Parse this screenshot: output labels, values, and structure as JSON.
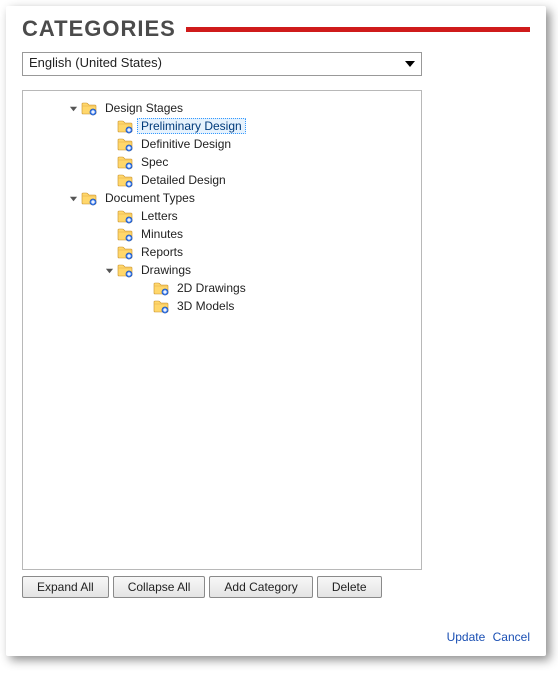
{
  "header": {
    "title": "CATEGORIES"
  },
  "language": {
    "selected": "English (United States)"
  },
  "buttons": {
    "expand_all": "Expand All",
    "collapse_all": "Collapse All",
    "add_category": "Add Category",
    "delete": "Delete"
  },
  "footer": {
    "update": "Update",
    "cancel": "Cancel"
  },
  "colors": {
    "accent": "#cf1b1b",
    "link": "#1a4fb3",
    "selection": "#e6f2fd"
  },
  "tree": [
    {
      "label": "Design Stages",
      "icon": "folder-tag-icon",
      "expanded": true,
      "children": [
        {
          "label": "Preliminary Design",
          "icon": "folder-tag-icon",
          "selected": true
        },
        {
          "label": "Definitive Design",
          "icon": "folder-tag-icon"
        },
        {
          "label": "Spec",
          "icon": "folder-tag-icon"
        },
        {
          "label": "Detailed Design",
          "icon": "folder-tag-icon"
        }
      ]
    },
    {
      "label": "Document Types",
      "icon": "folder-tag-icon",
      "expanded": true,
      "children": [
        {
          "label": "Letters",
          "icon": "folder-tag-icon"
        },
        {
          "label": "Minutes",
          "icon": "folder-tag-icon"
        },
        {
          "label": "Reports",
          "icon": "folder-tag-icon"
        },
        {
          "label": "Drawings",
          "icon": "folder-tag-icon",
          "expanded": true,
          "children": [
            {
              "label": "2D Drawings",
              "icon": "folder-tag-icon"
            },
            {
              "label": "3D Models",
              "icon": "folder-tag-icon"
            }
          ]
        }
      ]
    }
  ]
}
